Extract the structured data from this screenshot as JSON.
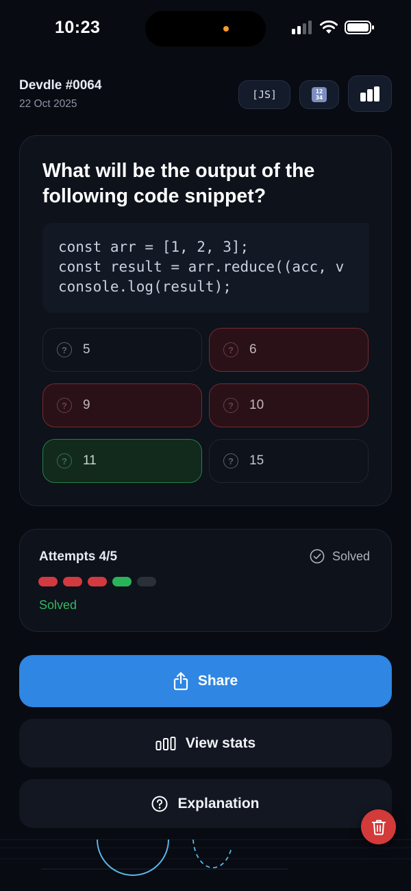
{
  "status_bar": {
    "time": "10:23"
  },
  "header": {
    "title": "Devdle #0064",
    "date": "22 Oct 2025",
    "language_button": "[JS]",
    "numbers_icon": "input-numbers-icon",
    "stats_icon": "bar-chart-icon"
  },
  "question": {
    "text": "What will be the output of the following code snippet?",
    "code": [
      "const arr = [1, 2, 3];",
      "const result = arr.reduce((acc, v",
      "console.log(result);"
    ],
    "options": [
      {
        "label": "5",
        "state": "neutral"
      },
      {
        "label": "6",
        "state": "wrong"
      },
      {
        "label": "9",
        "state": "wrong"
      },
      {
        "label": "10",
        "state": "wrong"
      },
      {
        "label": "11",
        "state": "correct"
      },
      {
        "label": "15",
        "state": "neutral"
      }
    ],
    "option_icon": "?"
  },
  "attempts": {
    "label": "Attempts 4/5",
    "status": "Solved",
    "result_text": "Solved",
    "dots": [
      "wrong",
      "wrong",
      "wrong",
      "correct",
      "unused"
    ]
  },
  "actions": {
    "share": "Share",
    "view_stats": "View stats",
    "explanation": "Explanation"
  },
  "colors": {
    "accent": "#2f86e3",
    "wrong": "#d23a3f",
    "correct": "#2bb35a",
    "unused": "#2a2f38"
  }
}
